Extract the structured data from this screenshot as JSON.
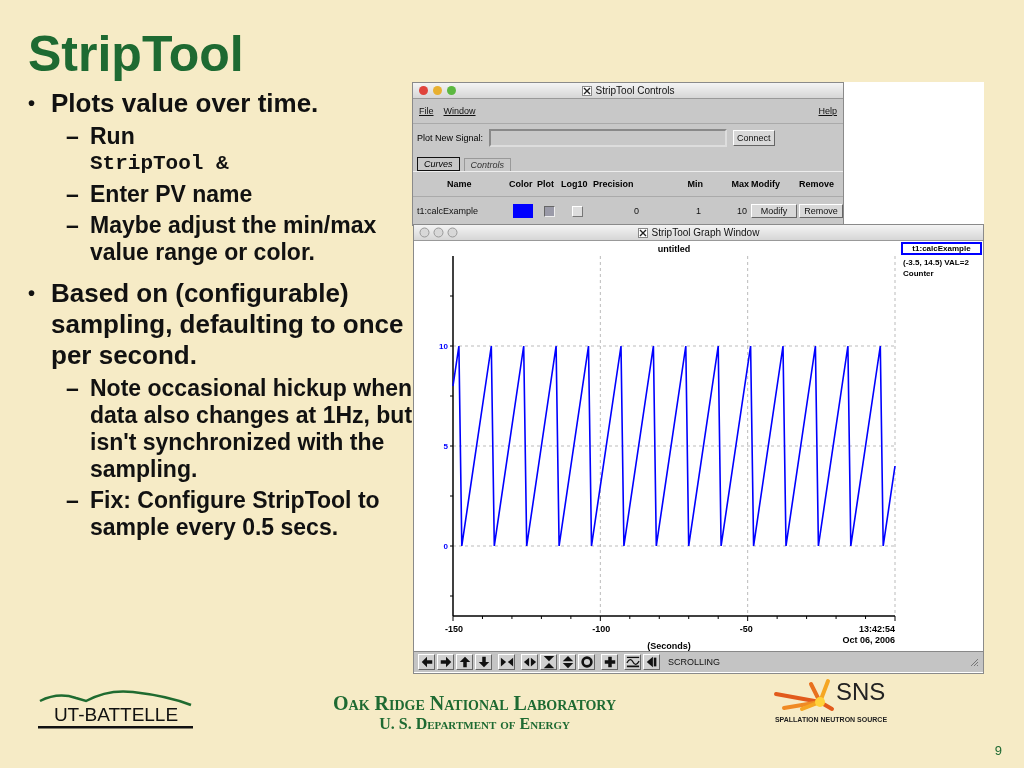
{
  "slide": {
    "title": "StripTool",
    "bullets": [
      {
        "marker": "•",
        "text": "Plots value over time.",
        "children": [
          {
            "marker": "–",
            "text": "Run",
            "code": "StripTool &"
          },
          {
            "marker": "–",
            "text": "Enter PV name"
          },
          {
            "marker": "–",
            "text": "Maybe adjust the min/max value range or color."
          }
        ]
      },
      {
        "marker": "•",
        "text": "Based on (configurable) sampling, defaulting to once per second.",
        "children": [
          {
            "marker": "–",
            "text": "Note occasional hickup when data also changes at 1Hz, but isn't synchronized with the sampling."
          },
          {
            "marker": "–",
            "text": "Fix: Configure StripTool to sample every 0.5 secs."
          }
        ]
      }
    ]
  },
  "controls_window": {
    "title": "StripTool Controls",
    "menus": [
      "File",
      "Window"
    ],
    "help": "Help",
    "signal_label": "Plot New Signal:",
    "connect": "Connect",
    "tabs": [
      {
        "label": "Curves",
        "selected": true
      },
      {
        "label": "Controls",
        "selected": false
      }
    ],
    "columns": [
      "Name",
      "Color",
      "Plot",
      "Log10",
      "Precision",
      "Min",
      "Max",
      "Modify",
      "Remove"
    ],
    "rows": [
      {
        "name": "t1:calcExample",
        "color": "#0000ff",
        "plot": true,
        "log10": false,
        "precision": "0",
        "min": "1",
        "max": "10",
        "modify": "Modify",
        "remove": "Remove"
      }
    ]
  },
  "graph_window": {
    "title": "StripTool Graph Window",
    "plot_title": "untitled",
    "legend": {
      "range": "(-3.5, 14.5) VAL=2",
      "description": "Counter"
    },
    "chart_data": {
      "type": "line",
      "xlabel": "(Seconds)",
      "xlim": [
        -150,
        0
      ],
      "ylim": [
        -3.5,
        14.5
      ],
      "xticks": [
        -150,
        -100,
        -50
      ],
      "yticks": [
        0,
        5,
        10
      ],
      "grid": true,
      "x": [
        -150,
        -148,
        -147,
        -137,
        -136,
        -126,
        -125,
        -115,
        -114,
        -104,
        -103,
        -93,
        -92,
        -82,
        -81,
        -71,
        -70,
        -60,
        -59,
        -49,
        -48,
        -38,
        -37,
        -27,
        -26,
        -16,
        -15,
        -5,
        -4,
        0
      ],
      "series": [
        {
          "name": "t1:calcExample",
          "color": "#0000ff",
          "values": [
            8,
            10,
            0,
            10,
            0,
            10,
            0,
            10,
            0,
            10,
            0,
            10,
            0,
            10,
            0,
            10,
            0,
            10,
            0,
            10,
            0,
            10,
            0,
            10,
            0,
            10,
            0,
            10,
            0,
            4
          ]
        }
      ]
    },
    "end_time": "13:42:54",
    "date": "Oct 06, 2006",
    "status": "SCROLLING"
  },
  "footer": {
    "left_logo": "UT-BATTELLE",
    "lab": "Oak Ridge National Laboratory",
    "department": "U. S. Department of Energy",
    "right_logo_mark": "SNS",
    "right_logo_caption": "SPALLATION NEUTRON SOURCE",
    "page": "9"
  }
}
